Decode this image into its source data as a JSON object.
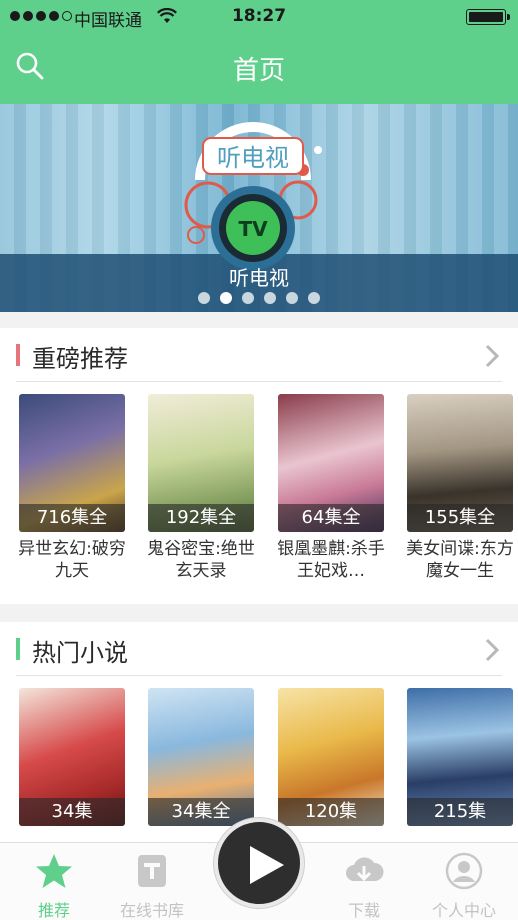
{
  "status_bar": {
    "carrier": "中国联通",
    "time": "18:27"
  },
  "nav": {
    "title": "首页",
    "search_icon": "search-icon"
  },
  "banner": {
    "caption": "听电视",
    "logo_text": "听电视",
    "slide_count": 6,
    "active_index": 1
  },
  "sections": [
    {
      "title": "重磅推荐",
      "accent": "#e8747b",
      "books": [
        {
          "count": "716集全",
          "title": "异世玄幻:破穷九天"
        },
        {
          "count": "192集全",
          "title": "鬼谷密宝:绝世玄天录"
        },
        {
          "count": "64集全",
          "title": "银凰墨麒:杀手王妃戏…"
        },
        {
          "count": "155集全",
          "title": "美女间谍:东方魔女一生"
        }
      ]
    },
    {
      "title": "热门小说",
      "accent": "#5fcf8c",
      "books": [
        {
          "count": "34集"
        },
        {
          "count": "34集全"
        },
        {
          "count": "120集"
        },
        {
          "count": "215集"
        }
      ]
    }
  ],
  "tabbar": {
    "tabs": [
      {
        "label": "推荐",
        "icon": "star-icon",
        "active": true
      },
      {
        "label": "在线书库",
        "icon": "book-icon",
        "active": false
      },
      {
        "label": "下载",
        "icon": "cloud-download-icon",
        "active": false
      },
      {
        "label": "个人中心",
        "icon": "user-icon",
        "active": false
      }
    ],
    "play_icon": "play-icon"
  },
  "colors": {
    "brand_green": "#5fcf8c",
    "accent_red": "#e8747b"
  }
}
